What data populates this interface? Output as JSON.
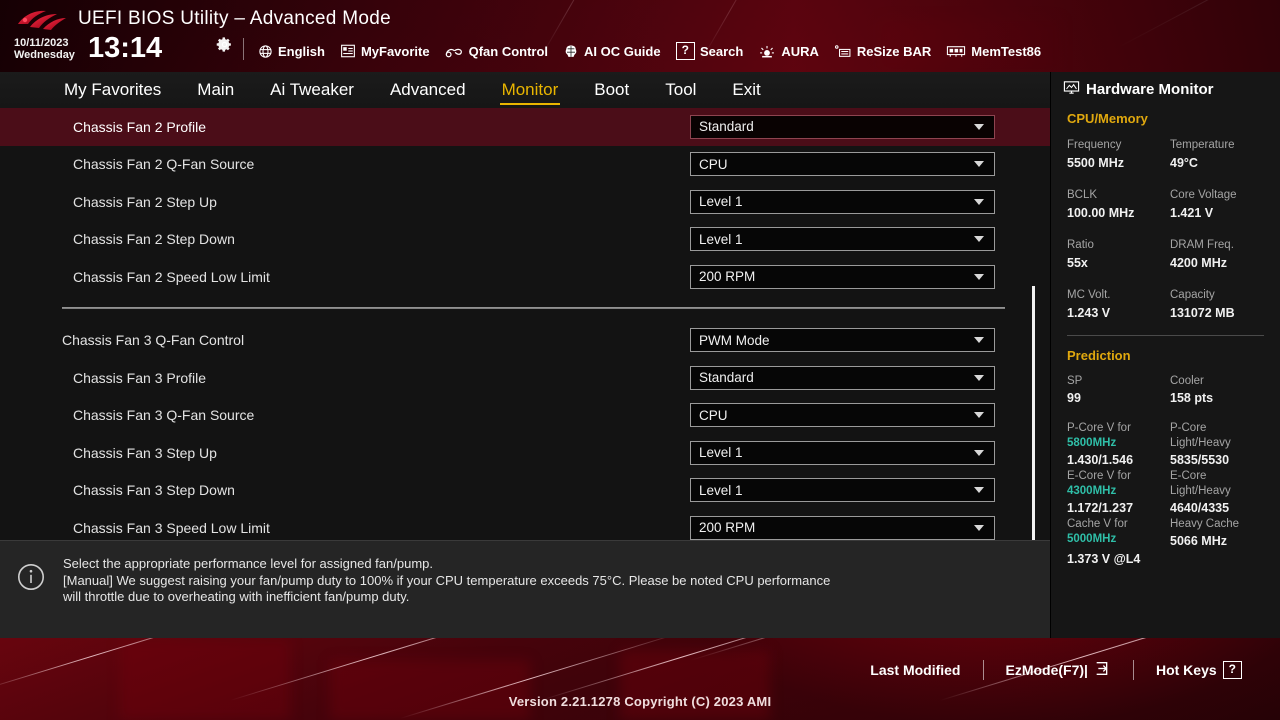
{
  "header": {
    "logo_icon": "rog-logo-icon",
    "title": "UEFI BIOS Utility – Advanced Mode",
    "date": "10/11/2023",
    "weekday": "Wednesday",
    "time": "13:14",
    "gear_icon": "gear-icon",
    "tools": [
      {
        "label": "English",
        "icon": "globe-icon"
      },
      {
        "label": "MyFavorite",
        "icon": "star-list-icon"
      },
      {
        "label": "Qfan Control",
        "icon": "fan-icon"
      },
      {
        "label": "AI OC Guide",
        "icon": "brain-icon"
      },
      {
        "label": "Search",
        "icon": "question-box-icon"
      },
      {
        "label": "AURA",
        "icon": "aura-light-icon"
      },
      {
        "label": "ReSize BAR",
        "icon": "resize-bar-icon"
      },
      {
        "label": "MemTest86",
        "icon": "memory-icon"
      }
    ]
  },
  "tabs": [
    {
      "label": "My Favorites",
      "active": false
    },
    {
      "label": "Main",
      "active": false
    },
    {
      "label": "Ai Tweaker",
      "active": false
    },
    {
      "label": "Advanced",
      "active": false
    },
    {
      "label": "Monitor",
      "active": true
    },
    {
      "label": "Boot",
      "active": false
    },
    {
      "label": "Tool",
      "active": false
    },
    {
      "label": "Exit",
      "active": false
    }
  ],
  "accent_colors": {
    "tab_active": "#e9b500",
    "selected_row": "#4b0d18",
    "section_heading": "#e0a80e",
    "prediction_freq": "#2fbfa8"
  },
  "settings": [
    {
      "label": "Chassis Fan 2 Profile",
      "value": "Standard",
      "selected": true,
      "indent": 1
    },
    {
      "label": "Chassis Fan 2 Q-Fan Source",
      "value": "CPU",
      "selected": false,
      "indent": 1
    },
    {
      "label": "Chassis Fan 2 Step Up",
      "value": "Level 1",
      "selected": false,
      "indent": 1
    },
    {
      "label": "Chassis Fan 2 Step Down",
      "value": "Level 1",
      "selected": false,
      "indent": 1
    },
    {
      "label": "Chassis Fan 2 Speed Low Limit",
      "value": "200 RPM",
      "selected": false,
      "indent": 1
    },
    {
      "label": "Chassis Fan 3 Q-Fan Control",
      "value": "PWM Mode",
      "selected": false,
      "indent": 0
    },
    {
      "label": "Chassis Fan 3 Profile",
      "value": "Standard",
      "selected": false,
      "indent": 1
    },
    {
      "label": "Chassis Fan 3 Q-Fan Source",
      "value": "CPU",
      "selected": false,
      "indent": 1
    },
    {
      "label": "Chassis Fan 3 Step Up",
      "value": "Level 1",
      "selected": false,
      "indent": 1
    },
    {
      "label": "Chassis Fan 3 Step Down",
      "value": "Level 1",
      "selected": false,
      "indent": 1
    },
    {
      "label": "Chassis Fan 3 Speed Low Limit",
      "value": "200 RPM",
      "selected": false,
      "indent": 1
    }
  ],
  "help": {
    "icon": "info-icon",
    "line1": "Select the appropriate performance level for assigned fan/pump.",
    "line2": "[Manual] We suggest raising your fan/pump duty to 100% if your CPU temperature exceeds 75°C. Please be noted CPU performance",
    "line3": "will throttle due to overheating with inefficient fan/pump duty."
  },
  "hardware_monitor": {
    "title": "Hardware Monitor",
    "title_icon": "monitor-icon",
    "cpu_memory": {
      "heading": "CPU/Memory",
      "pairs": [
        {
          "k1": "Frequency",
          "v1": "5500 MHz",
          "k2": "Temperature",
          "v2": "49°C"
        },
        {
          "k1": "BCLK",
          "v1": "100.00 MHz",
          "k2": "Core Voltage",
          "v2": "1.421 V"
        },
        {
          "k1": "Ratio",
          "v1": "55x",
          "k2": "DRAM Freq.",
          "v2": "4200 MHz"
        },
        {
          "k1": "MC Volt.",
          "v1": "1.243 V",
          "k2": "Capacity",
          "v2": "131072 MB"
        }
      ]
    },
    "prediction": {
      "heading": "Prediction",
      "sp_label": "SP",
      "sp_value": "99",
      "cooler_label": "Cooler",
      "cooler_value": "158 pts",
      "rows": [
        {
          "left_label": "P-Core V for",
          "left_freq": "5800MHz",
          "left_value": "1.430/1.546",
          "right_label1": "P-Core",
          "right_label2": "Light/Heavy",
          "right_value": "5835/5530"
        },
        {
          "left_label": "E-Core V for",
          "left_freq": "4300MHz",
          "left_value": "1.172/1.237",
          "right_label1": "E-Core",
          "right_label2": "Light/Heavy",
          "right_value": "4640/4335"
        },
        {
          "left_label": "Cache V for",
          "left_freq": "5000MHz",
          "left_value": "1.373 V @L4",
          "right_label1": "Heavy Cache",
          "right_label2": "",
          "right_value": "5066 MHz"
        }
      ]
    }
  },
  "footer": {
    "last_modified": "Last Modified",
    "ezmode": "EzMode(F7)|",
    "ezmode_icon": "exit-arrow-icon",
    "hot_keys": "Hot Keys",
    "hot_keys_glyph": "?",
    "version": "Version 2.21.1278 Copyright (C) 2023 AMI"
  }
}
